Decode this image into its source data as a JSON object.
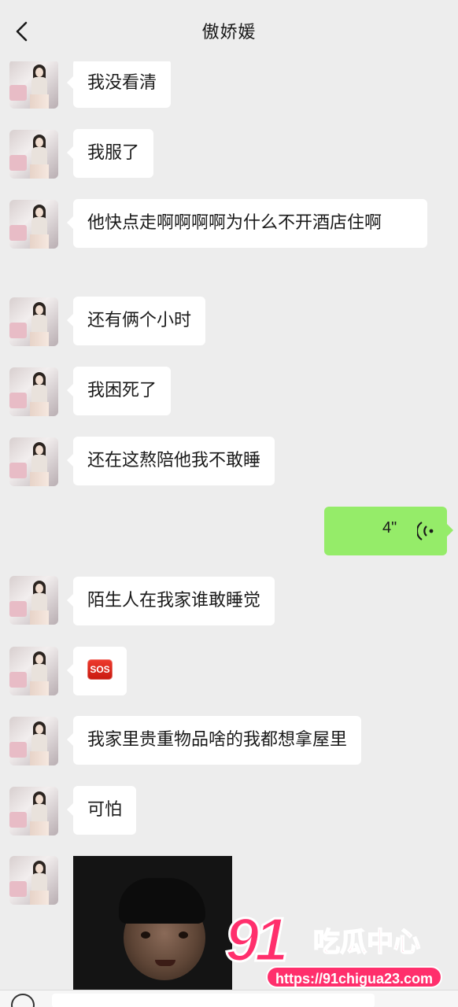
{
  "header": {
    "title": "傲娇媛",
    "back_icon": "chevron-left-icon"
  },
  "messages": [
    {
      "from": "contact",
      "text": "我没看清"
    },
    {
      "from": "contact",
      "text": "我服了"
    },
    {
      "from": "contact",
      "text": "他快点走啊啊啊啊为什么不开酒店住啊"
    },
    {
      "from": "contact",
      "text": "还有俩个小时"
    },
    {
      "from": "contact",
      "text": "我困死了"
    },
    {
      "from": "contact",
      "text": "还在这熬陪他我不敢睡"
    },
    {
      "from": "me",
      "type": "voice",
      "duration": "4\""
    },
    {
      "from": "contact",
      "text": "陌生人在我家谁敢睡觉"
    },
    {
      "from": "contact",
      "type": "emoji",
      "emoji_label": "SOS"
    },
    {
      "from": "contact",
      "text": "我家里贵重物品啥的我都想拿屋里"
    },
    {
      "from": "contact",
      "text": "可怕"
    },
    {
      "from": "contact",
      "type": "image"
    }
  ],
  "watermark": {
    "logo": "91",
    "brand": "吃瓜中心",
    "url": "https://91chigua23.com"
  },
  "colors": {
    "background": "#ededed",
    "bubble_in": "#ffffff",
    "bubble_out": "#95ec69",
    "watermark": "#ff2f6c"
  }
}
